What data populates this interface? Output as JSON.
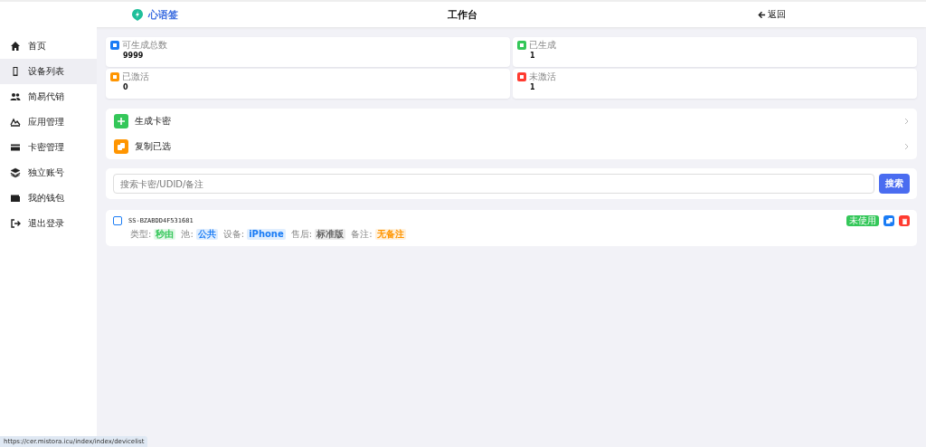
{
  "header": {
    "brand": "心语签",
    "title": "工作台",
    "back": "返回"
  },
  "sidebar": {
    "items": [
      {
        "label": "首页",
        "kind": "home",
        "selected": false
      },
      {
        "label": "设备列表",
        "kind": "phone",
        "selected": true
      },
      {
        "label": "简易代销",
        "kind": "users",
        "selected": false
      },
      {
        "label": "应用管理",
        "kind": "apps",
        "selected": false
      },
      {
        "label": "卡密管理",
        "kind": "card",
        "selected": false
      },
      {
        "label": "独立账号",
        "kind": "layers",
        "selected": false
      },
      {
        "label": "我的钱包",
        "kind": "wallet",
        "selected": false
      },
      {
        "label": "退出登录",
        "kind": "logout",
        "selected": false
      }
    ]
  },
  "stats": [
    {
      "label": "可生成总数",
      "value": "9999",
      "color": "#1a7cf5"
    },
    {
      "label": "已生成",
      "value": "1",
      "color": "#34c759"
    },
    {
      "label": "已激活",
      "value": "0",
      "color": "#ff9500"
    },
    {
      "label": "未激活",
      "value": "1",
      "color": "#ff3b30"
    }
  ],
  "actions": [
    {
      "label": "生成卡密",
      "kind": "plus",
      "color": "#34c759"
    },
    {
      "label": "复制已选",
      "kind": "copy",
      "color": "#ff9500"
    }
  ],
  "search": {
    "placeholder": "搜索卡密/UDID/备注",
    "button": "搜索"
  },
  "cards": [
    {
      "code": "SS-BZABDD4F531681",
      "checked": false,
      "status": "未使用",
      "tags": [
        {
          "key": "类型:",
          "value": "秒由",
          "color": "#34c759"
        },
        {
          "key": "池:",
          "value": "公共",
          "color": "#1a7cf5"
        },
        {
          "key": "设备:",
          "value": "iPhone",
          "color": "#1a7cf5"
        },
        {
          "key": "售后:",
          "value": "标准版",
          "color": "#666666"
        },
        {
          "key": "备注:",
          "value": "无备注",
          "color": "#ff9500"
        }
      ]
    }
  ],
  "status_bar": {
    "url": "https://cer.mistora.icu/index/index/devicelist"
  }
}
